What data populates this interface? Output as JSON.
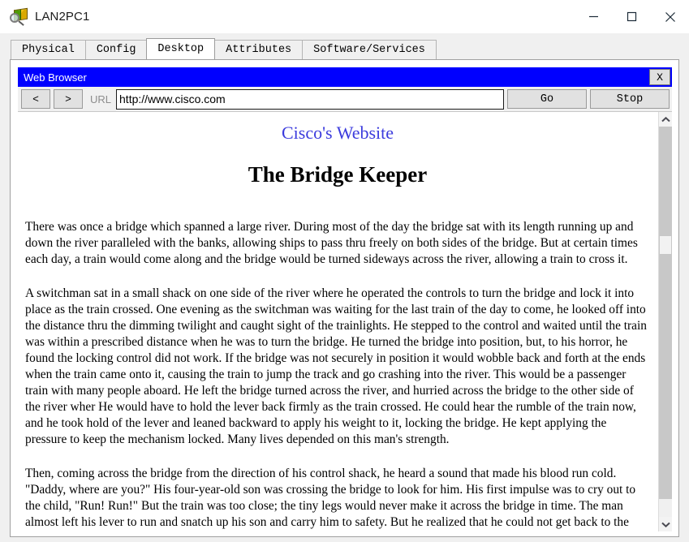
{
  "window": {
    "title": "LAN2PC1",
    "icon": "packet-tracer-icon",
    "controls": {
      "minimize": "minimize-icon",
      "maximize": "maximize-icon",
      "close": "close-icon"
    }
  },
  "device_tabs": [
    {
      "label": "Physical",
      "active": false
    },
    {
      "label": "Config",
      "active": false
    },
    {
      "label": "Desktop",
      "active": true
    },
    {
      "label": "Attributes",
      "active": false
    },
    {
      "label": "Software/Services",
      "active": false
    }
  ],
  "browser": {
    "title": "Web Browser",
    "close_label": "X",
    "toolbar": {
      "back_label": "<",
      "forward_label": ">",
      "url_label": "URL",
      "url_value": "http://www.cisco.com",
      "url_placeholder": "http://",
      "go_label": "Go",
      "stop_label": "Stop"
    },
    "scrollbar": {
      "up_arrow": "chevron-up-icon",
      "down_arrow": "chevron-down-icon",
      "thumb_position_percent": 31
    }
  },
  "page": {
    "site_title": "Cisco's Website",
    "heading": "The Bridge Keeper",
    "paragraphs": [
      "There was once a bridge which spanned a large river. During most of the day the bridge sat with its length running up and down the river paralleled with the banks, allowing ships to pass thru freely on both sides of the bridge. But at certain times each day, a train would come along and the bridge would be turned sideways across the river, allowing a train to cross it.",
      "A switchman sat in a small shack on one side of the river where he operated the controls to turn the bridge and lock it into place as the train crossed. One evening as the switchman was waiting for the last train of the day to come, he looked off into the distance thru the dimming twilight and caught sight of the trainlights. He stepped to the control and waited until the train was within a prescribed distance when he was to turn the bridge. He turned the bridge into position, but, to his horror, he found the locking control did not work. If the bridge was not securely in position it would wobble back and forth at the ends when the train came onto it, causing the train to jump the track and go crashing into the river. This would be a passenger train with many people aboard. He left the bridge turned across the river, and hurried across the bridge to the other side of the river wher He would have to hold the lever back firmly as the train crossed. He could hear the rumble of the train now, and he took hold of the lever and leaned backward to apply his weight to it, locking the bridge. He kept applying the pressure to keep the mechanism locked. Many lives depended on this man's strength.",
      "Then, coming across the bridge from the direction of his control shack, he heard a sound that made his blood run cold. \"Daddy, where are you?\" His four-year-old son was crossing the bridge to look for him. His first impulse was to cry out to the child, \"Run! Run!\" But the train was too close; the tiny legs would never make it across the bridge in time. The man almost left his lever to run and snatch up his son and carry him to safety. But he realized that he could not get back to the lever. Either the people on the train or his little son must die. He took a moment to make his decision."
    ]
  },
  "colors": {
    "browser_title_bar": "#0000ff",
    "site_link": "#3b3bdd",
    "window_background": "#f0f0f0"
  }
}
